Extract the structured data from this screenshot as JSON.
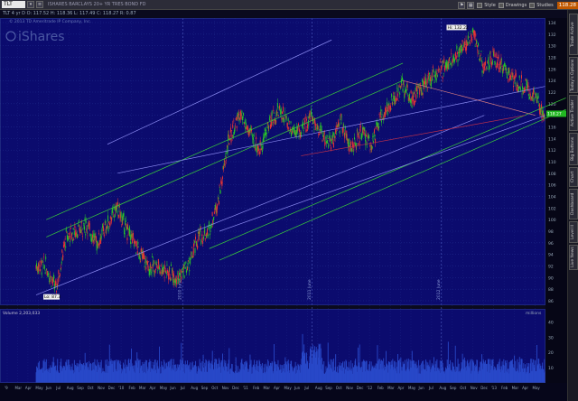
{
  "toolbar": {
    "symbol": "TLT",
    "description": "ISHARES BARCLAYS 20+ YR TRES BOND FD",
    "buttons": [
      {
        "label": "Style"
      },
      {
        "label": "Drawings"
      },
      {
        "label": "Studies"
      }
    ],
    "last_price": "118.28"
  },
  "quote_bar": "TLT 4 yr D   O: 117.52   H: 118.36   L: 117.49   C: 118.27   R: 0.87",
  "watermark": {
    "copyright": "© 2013 TD Ameritrade IP Company, Inc.",
    "brand": "iShares"
  },
  "side_tabs": [
    "Trade Active",
    "Today's Options",
    "Active Trader",
    "Big Buttons",
    "Chart",
    "Dashboard",
    "Level II",
    "Live News"
  ],
  "price_axis": {
    "ticks": [
      "134",
      "132",
      "130",
      "128",
      "126",
      "124",
      "122",
      "120",
      "118",
      "116",
      "114",
      "112",
      "110",
      "108",
      "106",
      "104",
      "102",
      "100",
      "98",
      "96",
      "94",
      "92",
      "90",
      "88",
      "86"
    ],
    "current_label": "118.27"
  },
  "volume_axis": {
    "ticks": [
      "40",
      "30",
      "20",
      "10"
    ],
    "unit": "millions"
  },
  "annotations": {
    "high": "Hi: 132.22",
    "low": "Lo: 87.3",
    "year_markers": [
      "2010 June",
      "2011 June",
      "2012 June"
    ]
  },
  "volume_panel": {
    "label": "Volume",
    "value": "2,203,033"
  },
  "x_axis": {
    "labels": [
      "'9",
      "Mar",
      "Apr",
      "May",
      "Jun",
      "Jul",
      "Aug",
      "Sep",
      "Oct",
      "Nov",
      "Dec",
      "'10",
      "Feb",
      "Mar",
      "Apr",
      "May",
      "Jun",
      "Jul",
      "Aug",
      "Sep",
      "Oct",
      "Nov",
      "Dec",
      "'11",
      "Feb",
      "Mar",
      "Apr",
      "May",
      "Jun",
      "Jul",
      "Aug",
      "Sep",
      "Oct",
      "Nov",
      "Dec",
      "'12",
      "Feb",
      "Mar",
      "Apr",
      "May",
      "Jun",
      "Jul",
      "Aug",
      "Sep",
      "Oct",
      "Nov",
      "Dec",
      "'13",
      "Feb",
      "Mar",
      "Apr",
      "May"
    ]
  },
  "colors": {
    "background": "#0a0a1e",
    "chart_bg": "#0b0b6e",
    "grid": "#2a3a9a",
    "channel_green": "#3ad03a",
    "channel_blue": "#8a8af0",
    "up_bar": "#29c429",
    "down_bar": "#e83535",
    "trend_red": "#c0304a",
    "trend_pink": "#e08080",
    "volume": "#2848c8",
    "current_price_bg": "#22b822"
  },
  "chart_data": {
    "type": "candlestick",
    "description_series": "TLT daily price (approx. monthly closes)",
    "months": [
      "Feb 09",
      "Mar 09",
      "Apr 09",
      "May 09",
      "Jun 09",
      "Jul 09",
      "Aug 09",
      "Sep 09",
      "Oct 09",
      "Nov 09",
      "Dec 09",
      "Jan 10",
      "Feb 10",
      "Mar 10",
      "Apr 10",
      "May 10",
      "Jun 10",
      "Jul 10",
      "Aug 10",
      "Sep 10",
      "Oct 10",
      "Nov 10",
      "Dec 10",
      "Jan 11",
      "Feb 11",
      "Mar 11",
      "Apr 11",
      "May 11",
      "Jun 11",
      "Jul 11",
      "Aug 11",
      "Sep 11",
      "Oct 11",
      "Nov 11",
      "Dec 11",
      "Jan 12",
      "Feb 12",
      "Mar 12",
      "Apr 12",
      "May 12",
      "Jun 12",
      "Jul 12",
      "Aug 12",
      "Sep 12",
      "Oct 12",
      "Nov 12",
      "Dec 12",
      "Jan 13",
      "Feb 13",
      "Mar 13"
    ],
    "close": [
      92,
      88,
      97,
      98,
      99,
      96,
      99,
      102,
      98,
      95,
      92,
      92,
      91,
      90,
      92,
      97,
      98,
      104,
      114,
      118,
      115,
      112,
      117,
      119,
      116,
      115,
      118,
      115,
      113,
      117,
      112,
      115,
      113,
      118,
      120,
      123,
      121,
      123,
      125,
      126,
      128,
      130,
      132,
      126,
      128,
      126,
      124,
      123,
      121,
      118
    ],
    "ylim": [
      86,
      134
    ],
    "high": 132.22,
    "low": 87.3,
    "last": 118.27
  }
}
